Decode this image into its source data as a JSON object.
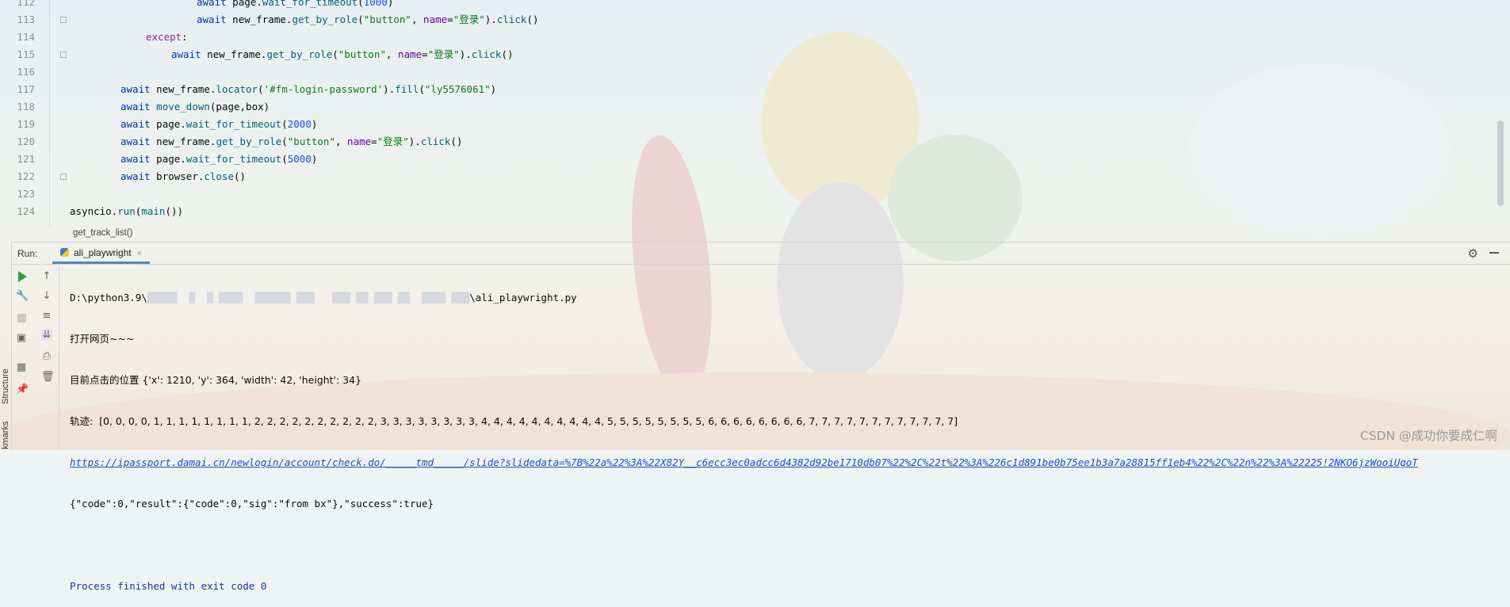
{
  "editor": {
    "lines": [
      {
        "num": "112",
        "parts": [
          {
            "t": "await",
            "c": "kw"
          },
          {
            "t": " page.",
            "c": ""
          },
          {
            "t": "wait_for_timeout",
            "c": "fn"
          },
          {
            "t": "(",
            "c": ""
          },
          {
            "t": "1000",
            "c": "num"
          },
          {
            "t": ")",
            "c": ""
          }
        ],
        "indent": 160
      },
      {
        "num": "113",
        "parts": [
          {
            "t": "await",
            "c": "kw"
          },
          {
            "t": " new_frame.",
            "c": ""
          },
          {
            "t": "get_by_role",
            "c": "fn"
          },
          {
            "t": "(",
            "c": ""
          },
          {
            "t": "\"button\"",
            "c": "str"
          },
          {
            "t": ", ",
            "c": ""
          },
          {
            "t": "name",
            "c": "par"
          },
          {
            "t": "=",
            "c": ""
          },
          {
            "t": "\"登录\"",
            "c": "str"
          },
          {
            "t": ").",
            "c": ""
          },
          {
            "t": "click",
            "c": "fn"
          },
          {
            "t": "()",
            "c": ""
          }
        ],
        "indent": 160,
        "fold": true
      },
      {
        "num": "114",
        "parts": [
          {
            "t": "except",
            "c": "ex"
          },
          {
            "t": ":",
            "c": ""
          }
        ],
        "indent": 96
      },
      {
        "num": "115",
        "parts": [
          {
            "t": "await",
            "c": "kw"
          },
          {
            "t": " new_frame.",
            "c": ""
          },
          {
            "t": "get_by_role",
            "c": "fn"
          },
          {
            "t": "(",
            "c": ""
          },
          {
            "t": "\"button\"",
            "c": "str"
          },
          {
            "t": ", ",
            "c": ""
          },
          {
            "t": "name",
            "c": "par"
          },
          {
            "t": "=",
            "c": ""
          },
          {
            "t": "\"登录\"",
            "c": "str"
          },
          {
            "t": ").",
            "c": ""
          },
          {
            "t": "click",
            "c": "fn"
          },
          {
            "t": "()",
            "c": ""
          }
        ],
        "indent": 128,
        "fold": true
      },
      {
        "num": "116",
        "parts": [],
        "indent": 0
      },
      {
        "num": "117",
        "parts": [
          {
            "t": "await",
            "c": "kw"
          },
          {
            "t": " new_frame.",
            "c": ""
          },
          {
            "t": "locator",
            "c": "fn"
          },
          {
            "t": "(",
            "c": ""
          },
          {
            "t": "'#fm-login-password'",
            "c": "str"
          },
          {
            "t": ").",
            "c": ""
          },
          {
            "t": "fill",
            "c": "fn"
          },
          {
            "t": "(",
            "c": ""
          },
          {
            "t": "\"ly5576061\"",
            "c": "str"
          },
          {
            "t": ")",
            "c": ""
          }
        ],
        "indent": 64
      },
      {
        "num": "118",
        "parts": [
          {
            "t": "await",
            "c": "kw"
          },
          {
            "t": " ",
            "c": ""
          },
          {
            "t": "move_down",
            "c": "fn"
          },
          {
            "t": "(page,box)",
            "c": ""
          }
        ],
        "indent": 64
      },
      {
        "num": "119",
        "parts": [
          {
            "t": "await",
            "c": "kw"
          },
          {
            "t": " page.",
            "c": ""
          },
          {
            "t": "wait_for_timeout",
            "c": "fn"
          },
          {
            "t": "(",
            "c": ""
          },
          {
            "t": "2000",
            "c": "num"
          },
          {
            "t": ")",
            "c": ""
          }
        ],
        "indent": 64
      },
      {
        "num": "120",
        "parts": [
          {
            "t": "await",
            "c": "kw"
          },
          {
            "t": " new_frame.",
            "c": ""
          },
          {
            "t": "get_by_role",
            "c": "fn"
          },
          {
            "t": "(",
            "c": ""
          },
          {
            "t": "\"button\"",
            "c": "str"
          },
          {
            "t": ", ",
            "c": ""
          },
          {
            "t": "name",
            "c": "par"
          },
          {
            "t": "=",
            "c": ""
          },
          {
            "t": "\"登录\"",
            "c": "str"
          },
          {
            "t": ").",
            "c": ""
          },
          {
            "t": "click",
            "c": "fn"
          },
          {
            "t": "()",
            "c": ""
          }
        ],
        "indent": 64
      },
      {
        "num": "121",
        "parts": [
          {
            "t": "await",
            "c": "kw"
          },
          {
            "t": " page.",
            "c": ""
          },
          {
            "t": "wait_for_timeout",
            "c": "fn"
          },
          {
            "t": "(",
            "c": ""
          },
          {
            "t": "5000",
            "c": "num"
          },
          {
            "t": ")",
            "c": ""
          }
        ],
        "indent": 64
      },
      {
        "num": "122",
        "parts": [
          {
            "t": "await",
            "c": "kw"
          },
          {
            "t": " browser.",
            "c": ""
          },
          {
            "t": "close",
            "c": "fn"
          },
          {
            "t": "()",
            "c": ""
          }
        ],
        "indent": 64,
        "fold": true
      },
      {
        "num": "123",
        "parts": [],
        "indent": 0
      },
      {
        "num": "124",
        "parts": [
          {
            "t": "asyncio.",
            "c": ""
          },
          {
            "t": "run",
            "c": "fn"
          },
          {
            "t": "(",
            "c": ""
          },
          {
            "t": "main",
            "c": "fn"
          },
          {
            "t": "())",
            "c": ""
          }
        ],
        "indent": 0
      }
    ],
    "breadcrumb": "get_track_list()"
  },
  "run_panel": {
    "label": "Run:",
    "tab_name": "ali_playwright",
    "tab_close": "×",
    "console": {
      "line1_prefix": "D:\\python3.9\\",
      "line1_hidden": "█████  █  █ ████  ██████ ███   ███ ██ ███ ██  ████ ███",
      "line1_suffix": "\\ali_playwright.py",
      "line2": "打开网页~~~",
      "line3": "目前点击的位置 {'x': 1210, 'y': 364, 'width': 42, 'height': 34}",
      "line4": "轨迹:  [0, 0, 0, 0, 1, 1, 1, 1, 1, 1, 1, 1, 2, 2, 2, 2, 2, 2, 2, 2, 2, 2, 3, 3, 3, 3, 3, 3, 3, 3, 4, 4, 4, 4, 4, 4, 4, 4, 4, 4, 5, 5, 5, 5, 5, 5, 5, 5, 6, 6, 6, 6, 6, 6, 6, 6, 7, 7, 7, 7, 7, 7, 7, 7, 7, 7, 7, 7]",
      "line5": "https://ipassport.damai.cn/newlogin/account/check.do/_____tmd_____/slide?slidedata=%7B%22a%22%3A%22X82Y__c6ecc3ec0adcc6d4382d92be1710db07%22%2C%22t%22%3A%226c1d891be0b75ee1b3a7a28815ff1eb4%22%2C%22n%22%3A%22225!2NKO6jzWooiUgoT",
      "line6": "{\"code\":0,\"result\":{\"code\":0,\"sig\":\"from bx\"},\"success\":true}",
      "line7": "",
      "line8": "Process finished with exit code 0"
    }
  },
  "side_labels": {
    "structure": "Structure",
    "bookmarks": "kmarks"
  },
  "watermark": "CSDN @成功你要成仁啊",
  "colors": {
    "keyword": "#0033b3",
    "string": "#067d17",
    "function": "#00627a",
    "number": "#1750eb",
    "link": "#1a4fcf"
  }
}
